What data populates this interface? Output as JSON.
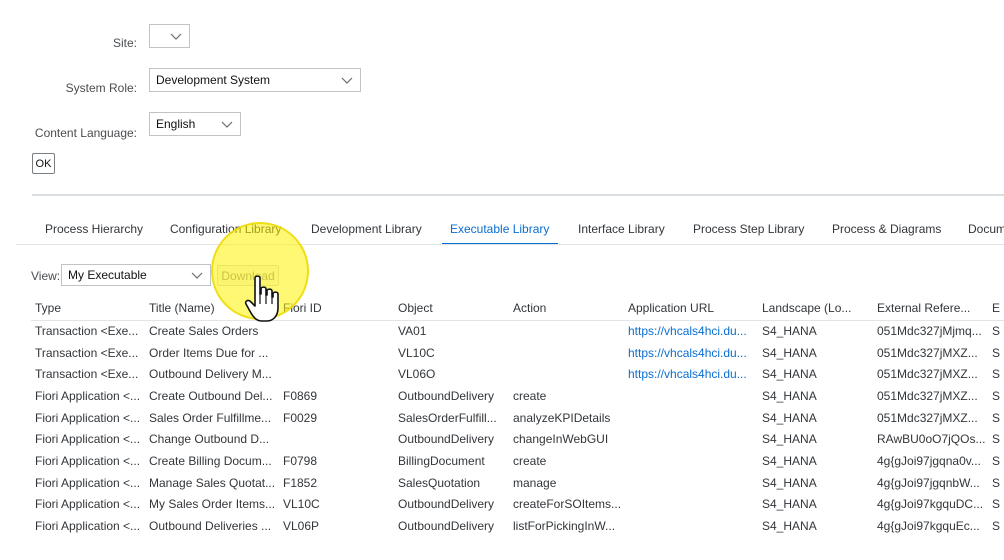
{
  "form": {
    "site_label": "Site:",
    "site_value": "",
    "system_role_label": "System Role:",
    "system_role_value": "Development System",
    "content_language_label": "Content Language:",
    "content_language_value": "English",
    "ok_label": "OK"
  },
  "tabs": [
    {
      "label": "Process Hierarchy",
      "active": false
    },
    {
      "label": "Configuration Library",
      "active": false
    },
    {
      "label": "Development Library",
      "active": false
    },
    {
      "label": "Executable Library",
      "active": true
    },
    {
      "label": "Interface Library",
      "active": false
    },
    {
      "label": "Process Step Library",
      "active": false
    },
    {
      "label": "Process & Diagrams",
      "active": false
    },
    {
      "label": "Docum",
      "active": false
    }
  ],
  "toolbar": {
    "view_label": "View:",
    "view_value": "My Executable",
    "download_label": "Download"
  },
  "colors": {
    "accent": "#0a6ed1",
    "highlight": "#fff200"
  },
  "table": {
    "columns": [
      "Type",
      "Title (Name)",
      "Fiori ID",
      "Object",
      "Action",
      "Application URL",
      "Landscape (Lo...",
      "External Refere...",
      "E"
    ],
    "rows": [
      [
        "Transaction <Exe...",
        "Create Sales Orders",
        "",
        "VA01",
        "",
        "https://vhcals4hci.du...",
        "S4_HANA",
        "051Mdc327jMjmq...",
        "S"
      ],
      [
        "Transaction <Exe...",
        "Order Items Due for ...",
        "",
        "VL10C",
        "",
        "https://vhcals4hci.du...",
        "S4_HANA",
        "051Mdc327jMXZ...",
        "S"
      ],
      [
        "Transaction <Exe...",
        "Outbound Delivery M...",
        "",
        "VL06O",
        "",
        "https://vhcals4hci.du...",
        "S4_HANA",
        "051Mdc327jMXZ...",
        "S"
      ],
      [
        "Fiori Application <...",
        "Create Outbound Del...",
        "F0869",
        "OutboundDelivery",
        "create",
        "",
        "S4_HANA",
        "051Mdc327jMXZ...",
        "S"
      ],
      [
        "Fiori Application <...",
        "Sales Order Fulfillme...",
        "F0029",
        "SalesOrderFulfill...",
        "analyzeKPIDetails",
        "",
        "S4_HANA",
        "051Mdc327jMXZ...",
        "S"
      ],
      [
        "Fiori Application <...",
        "Change Outbound D...",
        "",
        "OutboundDelivery",
        "changeInWebGUI",
        "",
        "S4_HANA",
        "RAwBU0oO7jQOs...",
        "S"
      ],
      [
        "Fiori Application <...",
        "Create Billing Docum...",
        "F0798",
        "BillingDocument",
        "create",
        "",
        "S4_HANA",
        "4g{gJoi97jgqna0v...",
        "S"
      ],
      [
        "Fiori Application <...",
        "Manage Sales Quotat...",
        "F1852",
        "SalesQuotation",
        "manage",
        "",
        "S4_HANA",
        "4g{gJoi97jgqnbW...",
        "S"
      ],
      [
        "Fiori Application <...",
        "My Sales Order Items...",
        "VL10C",
        "OutboundDelivery",
        "createForSOItems...",
        "",
        "S4_HANA",
        "4g{gJoi97kgquDC...",
        "S"
      ],
      [
        "Fiori Application <...",
        "Outbound Deliveries ...",
        "VL06P",
        "OutboundDelivery",
        "listForPickingInW...",
        "",
        "S4_HANA",
        "4g{gJoi97kgquEc...",
        "S"
      ]
    ]
  }
}
